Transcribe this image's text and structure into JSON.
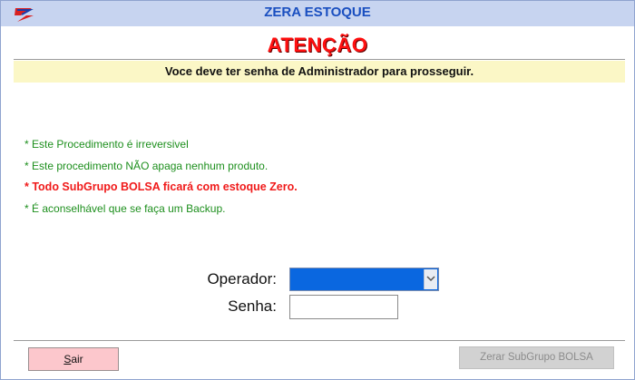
{
  "window": {
    "title": "ZERA ESTOQUE",
    "logo_icon": "app-logo-icon"
  },
  "heading": "ATENÇÃO",
  "notice": "Voce deve ter senha de Administrador para prosseguir.",
  "info_lines": [
    {
      "text": "* Este Procedimento é irreversivel",
      "color": "#1d8f1d"
    },
    {
      "text": "* Este procedimento NÃO apaga nenhum produto.",
      "color": "#1d8f1d"
    },
    {
      "text": "* Todo SubGrupo BOLSA ficará com estoque Zero.",
      "color": "#f01a1a"
    },
    {
      "text": "* É aconselhável que se faça um Backup.",
      "color": "#1d8f1d"
    }
  ],
  "form": {
    "operator_label": "Operador:",
    "operator_value": "",
    "password_label": "Senha:",
    "password_value": ""
  },
  "buttons": {
    "exit_mnemonic": "S",
    "exit_rest": "air",
    "zero": "Zerar SubGrupo BOLSA"
  },
  "colors": {
    "title": "#1a4fc0",
    "heading": "#ff1010",
    "notice_bg": "#fbf7c6",
    "exit_bg": "#fcc7cc",
    "select_bg": "#0a67e0"
  }
}
